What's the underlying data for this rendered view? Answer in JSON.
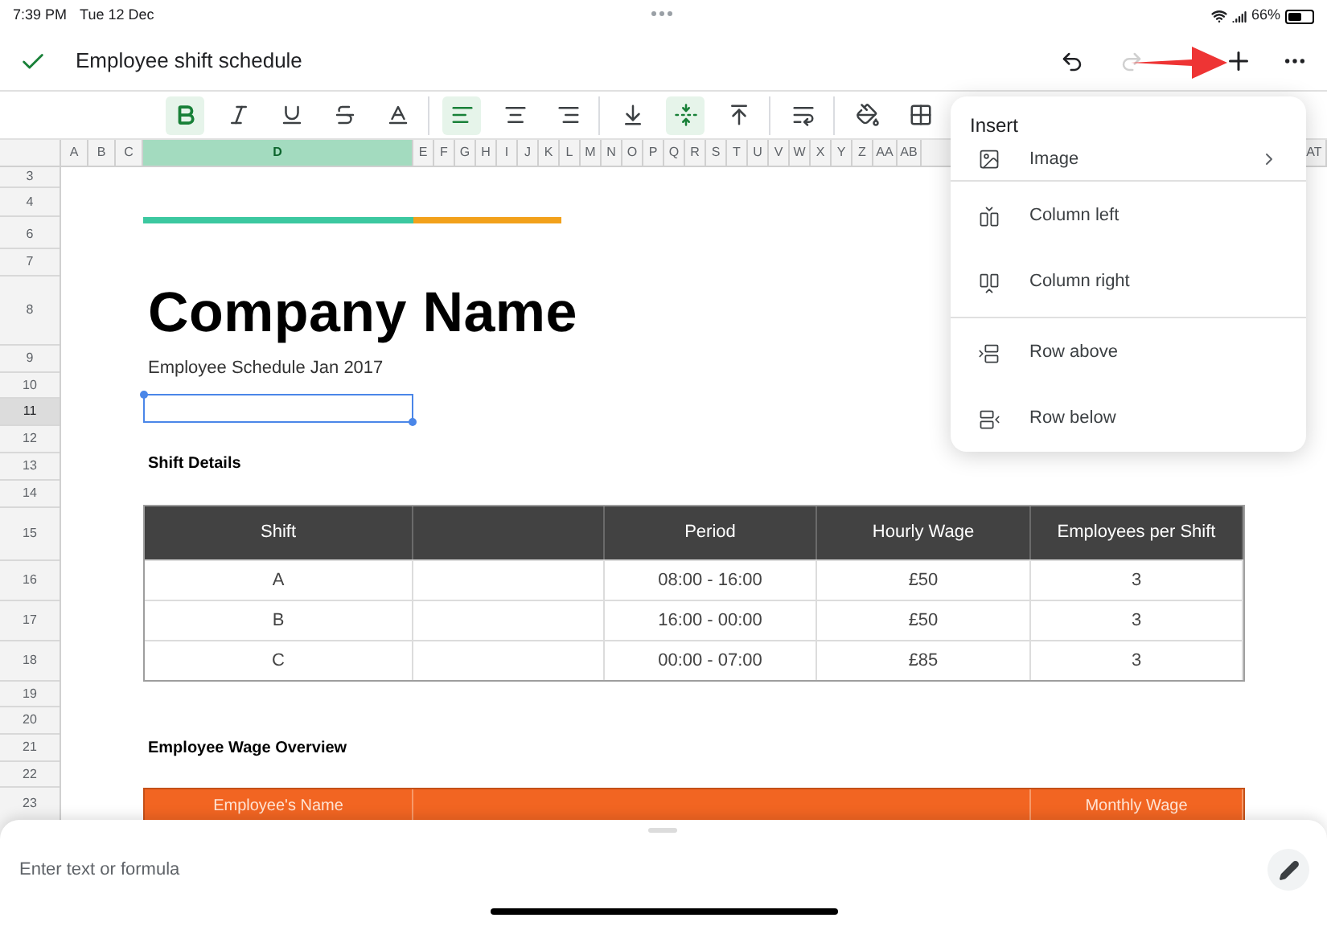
{
  "status_bar": {
    "time": "7:39 PM",
    "date": "Tue 12 Dec",
    "battery": "66%"
  },
  "title_bar": {
    "title": "Employee shift schedule",
    "redo_disabled": true
  },
  "toolbar_groups": [
    [
      {
        "kind": "bold",
        "selected": true
      },
      {
        "kind": "italic",
        "selected": false
      },
      {
        "kind": "underline",
        "selected": false
      },
      {
        "kind": "strike",
        "selected": false
      },
      {
        "kind": "text_color",
        "selected": false
      }
    ],
    [
      {
        "kind": "align_left",
        "selected": true
      },
      {
        "kind": "align_center",
        "selected": false
      },
      {
        "kind": "align_right",
        "selected": false
      }
    ],
    [
      {
        "kind": "valign_bottom",
        "selected": false
      },
      {
        "kind": "valign_middle",
        "selected": true
      },
      {
        "kind": "valign_top",
        "selected": false
      }
    ],
    [
      {
        "kind": "wrap",
        "selected": false
      }
    ],
    [
      {
        "kind": "fill",
        "selected": false
      },
      {
        "kind": "borders",
        "selected": false
      }
    ]
  ],
  "column_headers": [
    {
      "label": "A",
      "selected": false
    },
    {
      "label": "B",
      "selected": false
    },
    {
      "label": "C",
      "selected": false
    },
    {
      "label": "D",
      "selected": true
    },
    {
      "label": "E",
      "selected": false
    },
    {
      "label": "F",
      "selected": false
    },
    {
      "label": "G",
      "selected": false
    },
    {
      "label": "H",
      "selected": false
    },
    {
      "label": "I",
      "selected": false
    },
    {
      "label": "J",
      "selected": false
    },
    {
      "label": "K",
      "selected": false
    },
    {
      "label": "L",
      "selected": false
    },
    {
      "label": "M",
      "selected": false
    },
    {
      "label": "N",
      "selected": false
    },
    {
      "label": "O",
      "selected": false
    },
    {
      "label": "P",
      "selected": false
    },
    {
      "label": "Q",
      "selected": false
    },
    {
      "label": "R",
      "selected": false
    },
    {
      "label": "S",
      "selected": false
    },
    {
      "label": "T",
      "selected": false
    },
    {
      "label": "U",
      "selected": false
    },
    {
      "label": "V",
      "selected": false
    },
    {
      "label": "W",
      "selected": false
    },
    {
      "label": "X",
      "selected": false
    },
    {
      "label": "Y",
      "selected": false
    },
    {
      "label": "Z",
      "selected": false
    },
    {
      "label": "AA",
      "selected": false
    },
    {
      "label": "AB",
      "selected": false
    },
    {
      "label": "AT",
      "selected": false
    }
  ],
  "row_headers": [
    {
      "label": "3",
      "selected": false
    },
    {
      "label": "4",
      "selected": false
    },
    {
      "label": "6",
      "selected": false
    },
    {
      "label": "7",
      "selected": false
    },
    {
      "label": "8",
      "selected": false
    },
    {
      "label": "9",
      "selected": false
    },
    {
      "label": "10",
      "selected": false
    },
    {
      "label": "11",
      "selected": true
    },
    {
      "label": "12",
      "selected": false
    },
    {
      "label": "13",
      "selected": false
    },
    {
      "label": "14",
      "selected": false
    },
    {
      "label": "15",
      "selected": false
    },
    {
      "label": "16",
      "selected": false
    },
    {
      "label": "17",
      "selected": false
    },
    {
      "label": "18",
      "selected": false
    },
    {
      "label": "19",
      "selected": false
    },
    {
      "label": "20",
      "selected": false
    },
    {
      "label": "21",
      "selected": false
    },
    {
      "label": "22",
      "selected": false
    },
    {
      "label": "23",
      "selected": false
    }
  ],
  "sheet": {
    "title": "Company Name",
    "subtitle": "Employee Schedule Jan 2017",
    "shift_heading": "Shift Details",
    "shift_table": {
      "columns": [
        "Shift",
        null,
        "Period",
        "Hourly Wage",
        "Employees per Shift"
      ],
      "rows": [
        [
          "A",
          null,
          "08:00 - 16:00",
          "£50",
          "3"
        ],
        [
          "B",
          null,
          "16:00 - 00:00",
          "£50",
          "3"
        ],
        [
          "C",
          null,
          "00:00 - 07:00",
          "£85",
          "3"
        ]
      ]
    },
    "wage_heading": "Employee Wage Overview",
    "wage_table": {
      "columns": [
        "Employee's Name",
        null,
        "Monthly Wage"
      ]
    }
  },
  "menu": {
    "title": "Insert",
    "sections": [
      [
        {
          "kind": "image",
          "label": "Image",
          "submenu": true
        }
      ],
      [
        {
          "kind": "column_left",
          "label": "Column left",
          "submenu": false
        },
        {
          "kind": "column_right",
          "label": "Column right",
          "submenu": false
        }
      ],
      [
        {
          "kind": "row_above",
          "label": "Row above",
          "submenu": false
        },
        {
          "kind": "row_below",
          "label": "Row below",
          "submenu": false
        }
      ]
    ]
  },
  "formula_bar": {
    "placeholder": "Enter text or formula"
  }
}
